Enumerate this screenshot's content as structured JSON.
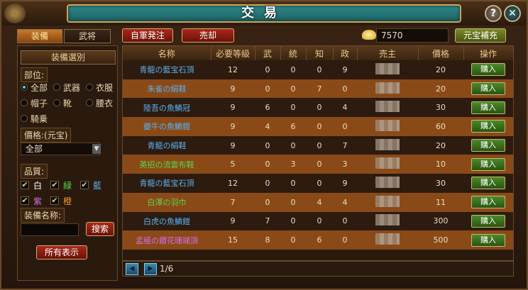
{
  "window": {
    "title": "交易",
    "help_glyph": "?",
    "close_glyph": "✕"
  },
  "tabs": [
    {
      "label": "装備"
    },
    {
      "label": "武将"
    }
  ],
  "actions": {
    "order_label": "自軍発注",
    "sell_label": "売却",
    "gold_amount": "7570",
    "recharge_label": "元宝補充"
  },
  "filter": {
    "header": "装備選別",
    "slot_label": "部位:",
    "slots": [
      {
        "label": "全部",
        "selected": true
      },
      {
        "label": "武器",
        "selected": false
      },
      {
        "label": "衣服",
        "selected": false
      },
      {
        "label": "帽子",
        "selected": false
      },
      {
        "label": "靴",
        "selected": false
      },
      {
        "label": "腰衣",
        "selected": false
      },
      {
        "label": "騎乗",
        "selected": false
      }
    ],
    "price_label": "價格:(元宝)",
    "price_selected": "全部",
    "quality_label": "品質:",
    "qualities": [
      {
        "label": "白",
        "color": "#ffffff",
        "checked": true
      },
      {
        "label": "緑",
        "color": "#5ad84a",
        "checked": true
      },
      {
        "label": "藍",
        "color": "#5ab0f0",
        "checked": true
      },
      {
        "label": "紫",
        "color": "#d86ae8",
        "checked": true
      },
      {
        "label": "橙",
        "color": "#f09a2a",
        "checked": true
      }
    ],
    "name_label": "装備名称:",
    "search_label": "搜索",
    "show_all_label": "所有表示"
  },
  "table": {
    "headers": [
      "名称",
      "必要等級",
      "武",
      "統",
      "知",
      "政",
      "売主",
      "價格",
      "操作"
    ],
    "buy_label": "購入",
    "rows": [
      {
        "name": "青龍の藍宝石頂",
        "color": "#5ab0f0",
        "level": "12",
        "wu": "0",
        "tong": "0",
        "zhi": "0",
        "zheng": "9",
        "price": "20"
      },
      {
        "name": "朱雀の絹鞋",
        "color": "#5ab0f0",
        "level": "9",
        "wu": "0",
        "tong": "0",
        "zhi": "7",
        "zheng": "0",
        "price": "20"
      },
      {
        "name": "陸吾の魚鱗冠",
        "color": "#5ab0f0",
        "level": "9",
        "wu": "6",
        "tong": "0",
        "zhi": "0",
        "zheng": "4",
        "price": "30"
      },
      {
        "name": "夔牛の魚鱗鎧",
        "color": "#5ab0f0",
        "level": "9",
        "wu": "4",
        "tong": "6",
        "zhi": "0",
        "zheng": "0",
        "price": "60"
      },
      {
        "name": "青龍の絹鞋",
        "color": "#5ab0f0",
        "level": "9",
        "wu": "0",
        "tong": "0",
        "zhi": "0",
        "zheng": "7",
        "price": "20"
      },
      {
        "name": "英招の流雲布鞋",
        "color": "#5ad84a",
        "level": "5",
        "wu": "0",
        "tong": "3",
        "zhi": "0",
        "zheng": "3",
        "price": "10"
      },
      {
        "name": "青龍の藍宝石頂",
        "color": "#5ab0f0",
        "level": "12",
        "wu": "0",
        "tong": "0",
        "zhi": "0",
        "zheng": "9",
        "price": "30"
      },
      {
        "name": "白澤の羽巾",
        "color": "#5ad84a",
        "level": "7",
        "wu": "0",
        "tong": "0",
        "zhi": "4",
        "zheng": "4",
        "price": "11"
      },
      {
        "name": "白虎の魚鱗鎧",
        "color": "#5ab0f0",
        "level": "9",
        "wu": "7",
        "tong": "0",
        "zhi": "0",
        "zheng": "0",
        "price": "300"
      },
      {
        "name": "孟極の鑽花珊瑚頂",
        "color": "#d86ae8",
        "level": "15",
        "wu": "8",
        "tong": "0",
        "zhi": "6",
        "zheng": "0",
        "price": "500"
      }
    ]
  },
  "pager": {
    "text": "1/6",
    "prev_glyph": "◀",
    "next_glyph": "▶"
  }
}
